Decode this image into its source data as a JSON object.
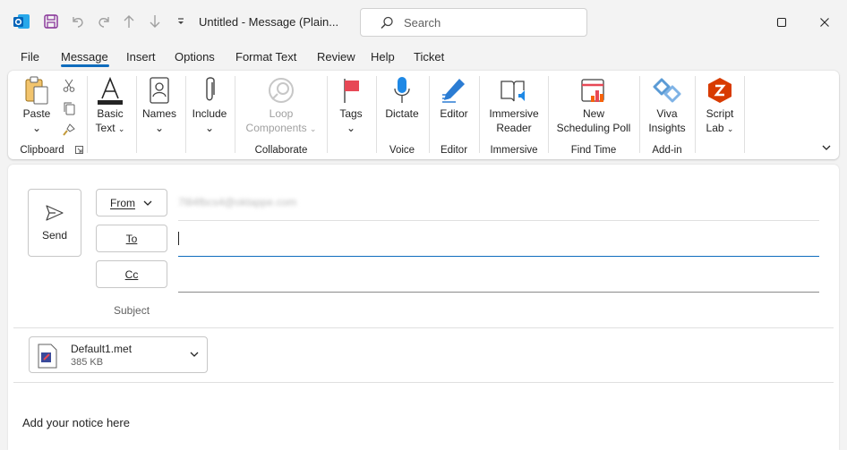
{
  "window": {
    "title": "Untitled  -  Message (Plain...",
    "search_placeholder": "Search"
  },
  "menu": {
    "tabs": [
      {
        "label": "File"
      },
      {
        "label": "Message"
      },
      {
        "label": "Insert"
      },
      {
        "label": "Options"
      },
      {
        "label": "Format Text"
      },
      {
        "label": "Review"
      },
      {
        "label": "Help"
      },
      {
        "label": "Ticket"
      }
    ],
    "active_tab": "Message"
  },
  "ribbon": {
    "groups": [
      {
        "label": "Clipboard"
      },
      {
        "label": "Collaborate"
      },
      {
        "label": "Voice"
      },
      {
        "label": "Editor"
      },
      {
        "label": "Immersive"
      },
      {
        "label": "Find Time"
      },
      {
        "label": "Add-in"
      }
    ],
    "buttons": {
      "paste": "Paste",
      "basic_text_1": "Basic",
      "basic_text_2": "Text",
      "names": "Names",
      "include": "Include",
      "loop_1": "Loop",
      "loop_2": "Components",
      "tags": "Tags",
      "dictate": "Dictate",
      "editor": "Editor",
      "immersive_1": "Immersive",
      "immersive_2": "Reader",
      "scheduling_1": "New",
      "scheduling_2": "Scheduling Poll",
      "viva_1": "Viva",
      "viva_2": "Insights",
      "script_1": "Script",
      "script_2": "Lab"
    }
  },
  "compose": {
    "send_label": "Send",
    "from_label": "From",
    "from_address": "7l84fbcs4@oktappe.com",
    "to_label": "To",
    "cc_label": "Cc",
    "subject_label": "Subject",
    "attachment": {
      "name": "Default1.met",
      "size": "385 KB"
    },
    "body": "Add your notice here"
  },
  "colors": {
    "accent": "#0f6cbd",
    "outlook_blue": "#0364b8",
    "save_purple": "#8b3a9b",
    "script_lab_orange": "#d83b01"
  }
}
